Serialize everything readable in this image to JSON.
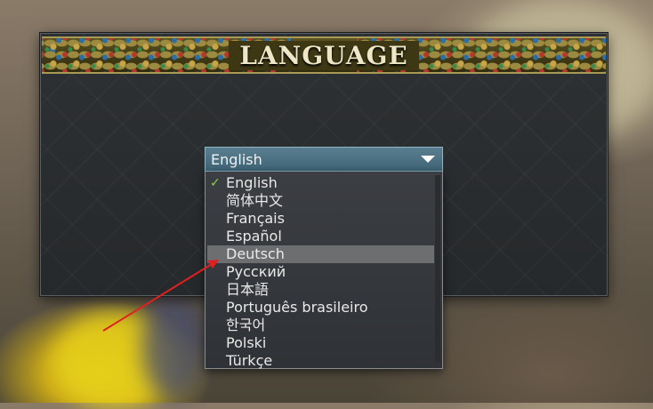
{
  "dialog": {
    "title": "LANGUAGE"
  },
  "language_select": {
    "selected": "English",
    "options": [
      "English",
      "简体中文",
      "Français",
      "Español",
      "Deutsch",
      "Русский",
      "日本語",
      "Português brasileiro",
      "한국어",
      "Polski",
      "Türkçe"
    ],
    "checked_option": "English",
    "hovered_option": "Deutsch"
  },
  "colors": {
    "select_background": "#4a7285",
    "hover_row": "#6c6e70",
    "checkmark": "#8fd14f",
    "annotation_arrow": "#e02020"
  },
  "icons": {
    "check": "check-icon",
    "dropdown": "caret-down-icon"
  }
}
